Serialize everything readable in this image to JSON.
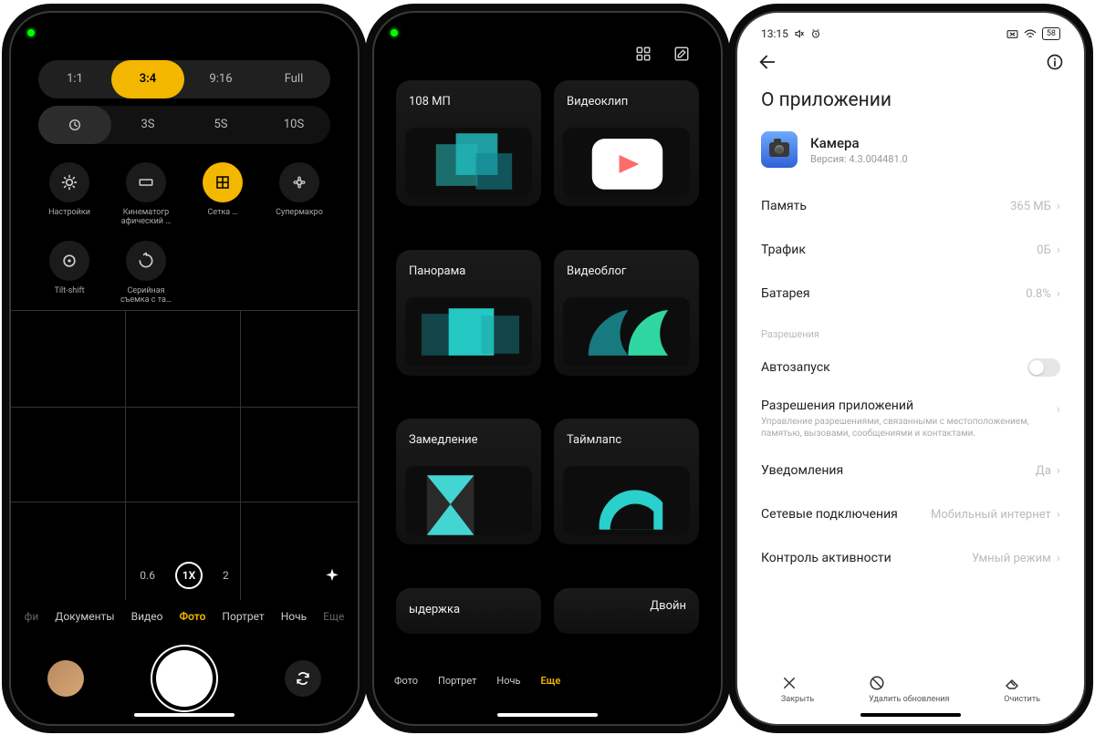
{
  "phone1": {
    "ratios": [
      "1:1",
      "3:4",
      "9:16",
      "Full"
    ],
    "ratio_active": 1,
    "timers": [
      "",
      "3S",
      "5S",
      "10S"
    ],
    "timer_active": 0,
    "options": [
      {
        "icon": "settings",
        "label": "Настройки"
      },
      {
        "icon": "cinema",
        "label": "Кинематогр\nафический …"
      },
      {
        "icon": "grid",
        "label": "Сетка …",
        "on": true
      },
      {
        "icon": "macro",
        "label": "Супермакро"
      },
      {
        "icon": "tilt",
        "label": "Tilt-shift"
      },
      {
        "icon": "burst",
        "label": "Серийная\nсъемка с та…"
      }
    ],
    "zoom": [
      "0.6",
      "1X",
      "2"
    ],
    "modes": [
      "фи",
      "Документы",
      "Видео",
      "Фото",
      "Портрет",
      "Ночь",
      "Еще"
    ],
    "mode_active": 3
  },
  "phone2": {
    "cards": [
      "108 МП",
      "Видеоклип",
      "Панорама",
      "Видеоблог",
      "Замедление",
      "Таймлапс",
      "ыдержка",
      "Двойн"
    ],
    "modes": [
      "Фото",
      "Портрет",
      "Ночь",
      "Еще"
    ],
    "mode_active": 3
  },
  "phone3": {
    "time": "13:15",
    "battery": "58",
    "title": "О приложении",
    "app_name": "Камера",
    "app_version": "Версия: 4.3.004481.0",
    "rows": [
      {
        "label": "Память",
        "value": "365 МБ"
      },
      {
        "label": "Трафик",
        "value": "0Б"
      },
      {
        "label": "Батарея",
        "value": "0.8%"
      }
    ],
    "section": "Разрешения",
    "autostart": "Автозапуск",
    "perm_row": {
      "label": "Разрешения приложений",
      "sub": "Управление разрешениями, связанными с местоположением, памятью, вызовами, сообщениями и контактами."
    },
    "rows2": [
      {
        "label": "Уведомления",
        "value": "Да"
      },
      {
        "label": "Сетевые подключения",
        "value": "Мобильный интернет"
      },
      {
        "label": "Контроль активности",
        "value": "Умный режим"
      }
    ],
    "actions": [
      "Закрыть",
      "Удалить обновления",
      "Очистить"
    ]
  }
}
